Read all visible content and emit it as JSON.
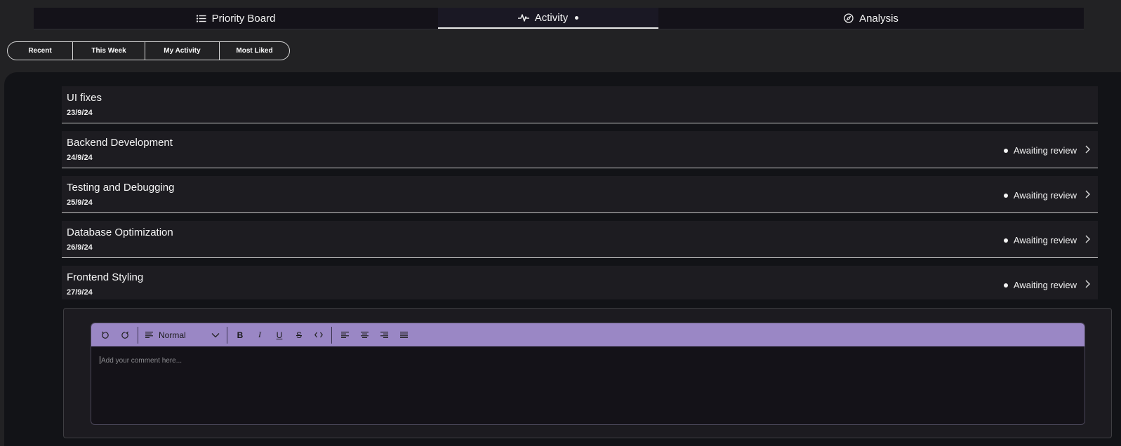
{
  "nav": {
    "tabs": [
      {
        "label": "Priority Board",
        "icon": "list-icon"
      },
      {
        "label": "Activity",
        "icon": "activity-icon"
      },
      {
        "label": "Analysis",
        "icon": "compass-icon"
      }
    ]
  },
  "filters": [
    "Recent",
    "This Week",
    "My Activity",
    "Most Liked"
  ],
  "items": [
    {
      "title": "UI fixes",
      "date": "23/9/24",
      "status": ""
    },
    {
      "title": "Backend Development",
      "date": "24/9/24",
      "status": "Awaiting review"
    },
    {
      "title": "Testing and Debugging",
      "date": "25/9/24",
      "status": "Awaiting review"
    },
    {
      "title": "Database Optimization",
      "date": "26/9/24",
      "status": "Awaiting review"
    },
    {
      "title": "Frontend Styling",
      "date": "27/9/24",
      "status": "Awaiting review"
    }
  ],
  "editor": {
    "block_type": "Normal",
    "placeholder": "Add your comment here...",
    "toolbar_color": "#9a87c5"
  }
}
